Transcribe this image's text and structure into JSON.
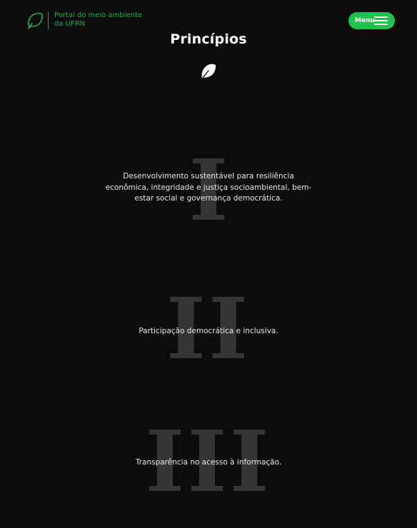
{
  "header": {
    "brand_text": "Portal do meio ambiente da UFRN",
    "menu_label": "Menu"
  },
  "page": {
    "title": "Princípios"
  },
  "principles": [
    {
      "numeral": "I",
      "text": "Desenvolvimento sustentável para resiliência econômica, integridade e justiça socioambiental, bem-estar social e governança democrática."
    },
    {
      "numeral": "II",
      "text": "Participação democrática e inclusiva."
    },
    {
      "numeral": "III",
      "text": "Transparência no acesso à informação."
    }
  ],
  "colors": {
    "background": "#0c0c0c",
    "accent": "#1fc24f",
    "numeral": "#353535"
  }
}
